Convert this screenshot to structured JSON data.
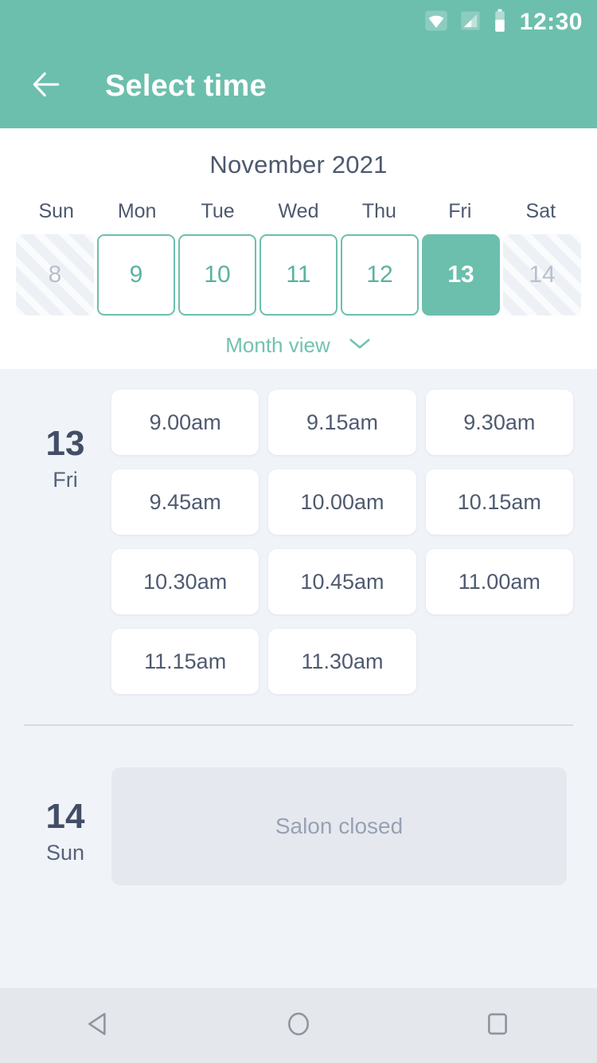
{
  "statusbar": {
    "time": "12:30",
    "icons": [
      "wifi-icon",
      "cell-signal-icon",
      "battery-icon"
    ]
  },
  "appbar": {
    "title": "Select time",
    "back_icon": "arrow-left-icon",
    "accent_color": "#6CBFAD"
  },
  "calendar": {
    "month_title": "November 2021",
    "weekday_headers": [
      "Sun",
      "Mon",
      "Tue",
      "Wed",
      "Thu",
      "Fri",
      "Sat"
    ],
    "days": [
      {
        "number": "8",
        "state": "disabled"
      },
      {
        "number": "9",
        "state": "available"
      },
      {
        "number": "10",
        "state": "available"
      },
      {
        "number": "11",
        "state": "available"
      },
      {
        "number": "12",
        "state": "available"
      },
      {
        "number": "13",
        "state": "selected"
      },
      {
        "number": "14",
        "state": "disabled"
      }
    ],
    "month_view_label": "Month view",
    "month_view_icon": "chevron-down-icon"
  },
  "schedule": [
    {
      "date_number": "13",
      "date_weekday": "Fri",
      "slots": [
        "9.00am",
        "9.15am",
        "9.30am",
        "9.45am",
        "10.00am",
        "10.15am",
        "10.30am",
        "10.45am",
        "11.00am",
        "11.15am",
        "11.30am"
      ]
    },
    {
      "date_number": "14",
      "date_weekday": "Sun",
      "closed_message": "Salon closed"
    }
  ],
  "navbar": {
    "back_icon": "triangle-back-icon",
    "home_icon": "circle-home-icon",
    "recents_icon": "square-recents-icon"
  },
  "colors": {
    "accent": "#6CBFAD",
    "slot_bg": "#FFFFFF",
    "page_bg": "#F0F3F8",
    "text_dark": "#4D596F",
    "text_muted": "#98A1B3"
  }
}
